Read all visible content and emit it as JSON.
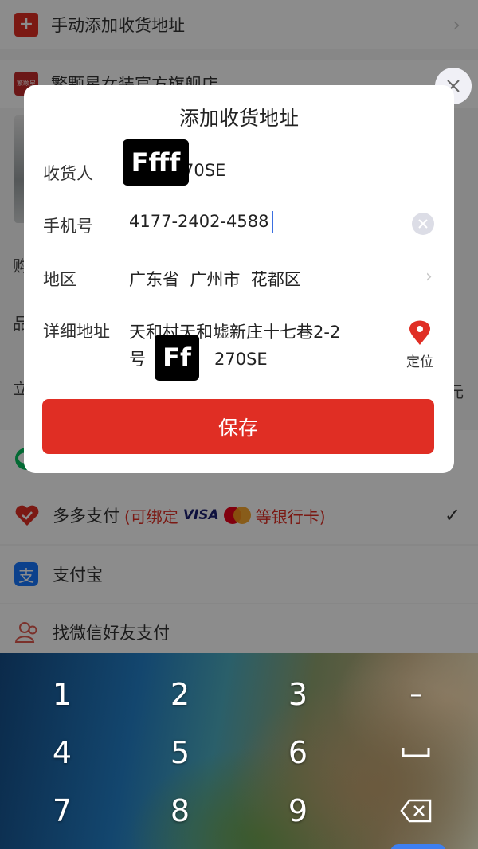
{
  "background": {
    "add_address_label": "手动添加收货地址",
    "shop_name": "繁颗星女装官方旗舰店",
    "shop_logo_text": "繁颗星",
    "partial_left_1": "购",
    "partial_left_2": "品",
    "partial_left_3": "立",
    "partial_right": "元",
    "payment_methods": [
      {
        "label": "多多支付",
        "note_open": "(可绑定",
        "visa": "VISA",
        "note_close": "等银行卡)"
      },
      {
        "label": "支付宝"
      },
      {
        "label": "找微信好友支付"
      }
    ],
    "colors": {
      "accent": "#e02e24"
    }
  },
  "dialog": {
    "title": "添加收货地址",
    "recipient_label": "收货人",
    "recipient_value": "70SE",
    "recipient_redaction": "Ffff",
    "phone_label": "手机号",
    "phone_value": "4177-2402-4588",
    "region_label": "地区",
    "region_value": "广东省  广州市  花都区",
    "address_label": "详细地址",
    "address_line1": "天和村天和墟新庄十七巷2-2",
    "address_line2_prefix": "号",
    "address_line2_suffix": "270SE",
    "address_redaction": "Ff",
    "locate_label": "定位",
    "save_label": "保存"
  },
  "keyboard": {
    "keys": [
      "1",
      "2",
      "3",
      "–",
      "4",
      "5",
      "6",
      "␣",
      "7",
      "8",
      "9",
      "⌫"
    ]
  }
}
